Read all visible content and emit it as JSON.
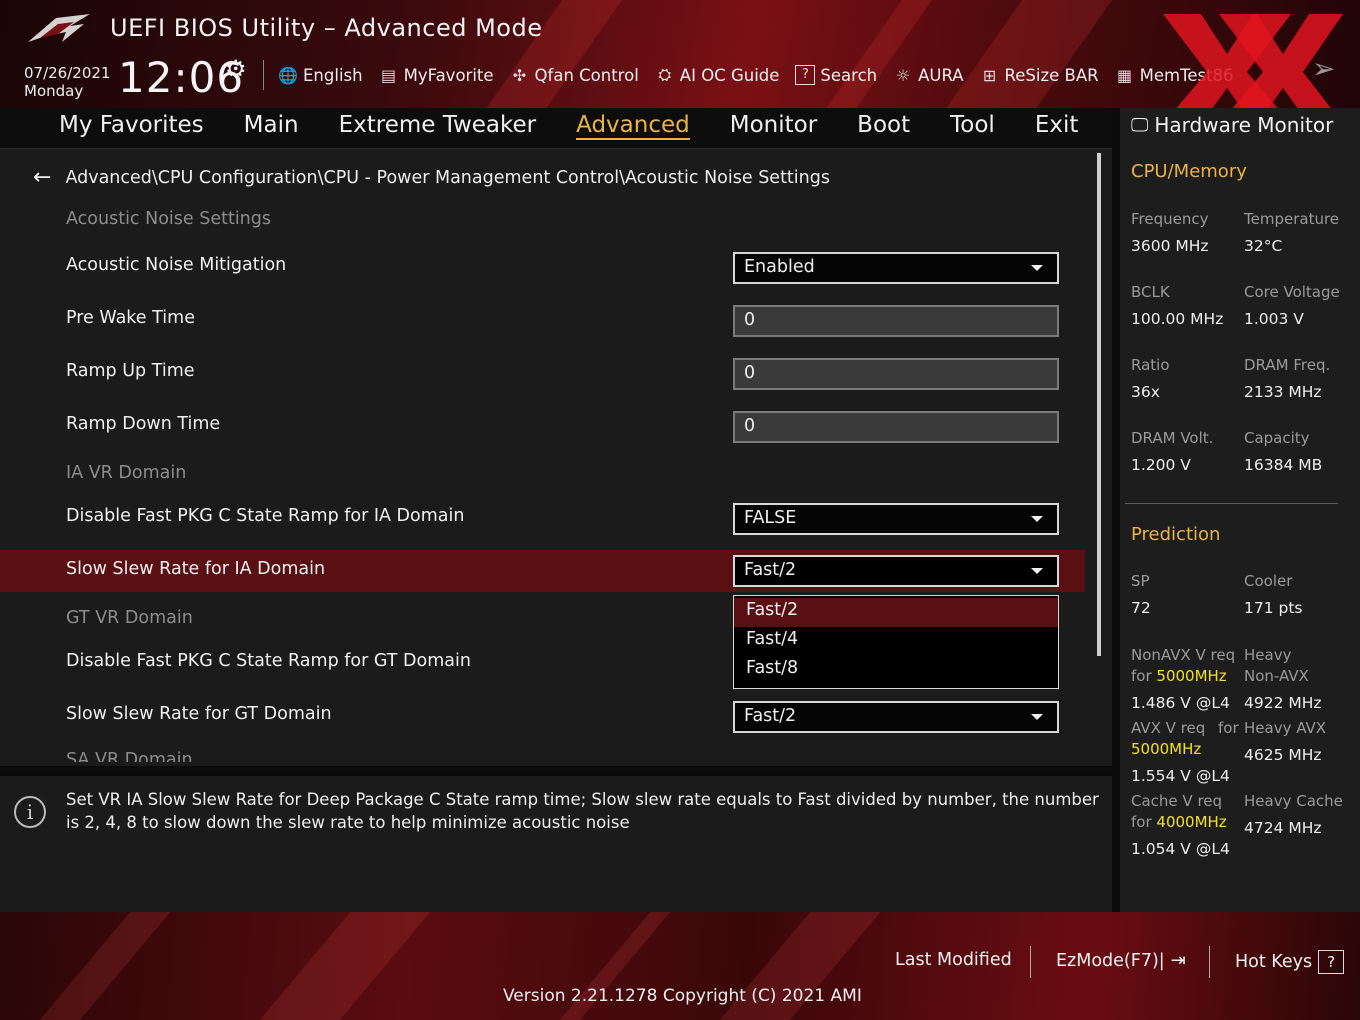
{
  "header": {
    "title": "UEFI BIOS Utility – Advanced Mode",
    "date": "07/26/2021",
    "day": "Monday",
    "time": "12:06",
    "tools": [
      {
        "label": "English",
        "icon": "globe-icon"
      },
      {
        "label": "MyFavorite",
        "icon": "favorite-icon"
      },
      {
        "label": "Qfan Control",
        "icon": "fan-icon"
      },
      {
        "label": "AI OC Guide",
        "icon": "ai-chip-icon"
      },
      {
        "label": "Search",
        "icon": "search-icon"
      },
      {
        "label": "AURA",
        "icon": "aura-light-icon"
      },
      {
        "label": "ReSize BAR",
        "icon": "resize-bar-icon"
      },
      {
        "label": "MemTest86",
        "icon": "memtest-icon"
      }
    ]
  },
  "nav": {
    "tabs": [
      "My Favorites",
      "Main",
      "Extreme Tweaker",
      "Advanced",
      "Monitor",
      "Boot",
      "Tool",
      "Exit"
    ],
    "active": "Advanced"
  },
  "main": {
    "breadcrumb": "Advanced\\CPU Configuration\\CPU - Power Management Control\\Acoustic Noise Settings",
    "rows": {
      "section1": "Acoustic Noise Settings",
      "mitigation_label": "Acoustic Noise Mitigation",
      "mitigation_value": "Enabled",
      "prewake_label": "Pre Wake Time",
      "prewake_value": "0",
      "rampup_label": "Ramp Up Time",
      "rampup_value": "0",
      "rampdown_label": "Ramp Down Time",
      "rampdown_value": "0",
      "section_ia": "IA VR Domain",
      "disable_ia_label": "Disable Fast PKG C State Ramp for IA Domain",
      "disable_ia_value": "FALSE",
      "slew_ia_label": "Slow Slew Rate for IA Domain",
      "slew_ia_value": "Fast/2",
      "section_gt": "GT VR Domain",
      "disable_gt_label": "Disable Fast PKG C State Ramp for GT Domain",
      "slew_gt_label": "Slow Slew Rate for GT Domain",
      "slew_gt_value": "Fast/2",
      "section_sa_clipped": "SA VR Domain"
    },
    "dropdown_options": [
      "Fast/2",
      "Fast/4",
      "Fast/8"
    ]
  },
  "info": {
    "text": "Set VR IA Slow Slew Rate for Deep Package C State ramp time; Slow slew rate equals to Fast divided by number, the number is 2, 4, 8 to slow down the slew rate to help minimize acoustic noise"
  },
  "hw_monitor": {
    "title": "Hardware Monitor",
    "cpu_section": "CPU/Memory",
    "cpu": [
      {
        "k": "Frequency",
        "v": "3600 MHz"
      },
      {
        "k": "Temperature",
        "v": "32°C"
      },
      {
        "k": "BCLK",
        "v": "100.00 MHz"
      },
      {
        "k": "Core Voltage",
        "v": "1.003 V"
      },
      {
        "k": "Ratio",
        "v": "36x"
      },
      {
        "k": "DRAM Freq.",
        "v": "2133 MHz"
      },
      {
        "k": "DRAM Volt.",
        "v": "1.200 V"
      },
      {
        "k": "Capacity",
        "v": "16384 MB"
      }
    ],
    "prediction_section": "Prediction",
    "sp_label": "SP",
    "sp_value": "72",
    "cooler_label": "Cooler",
    "cooler_value": "171 pts",
    "nonavx_label": "NonAVX V req",
    "nonavx_for": "for",
    "nonavx_freq": "5000MHz",
    "nonavx_value": "1.486 V @L4",
    "heavy_nonavx_label1": "Heavy",
    "heavy_nonavx_label2": "Non-AVX",
    "heavy_nonavx_value": "4922 MHz",
    "avx_label": "AVX V req",
    "avx_for": "for",
    "avx_freq": "5000MHz",
    "avx_value": "1.554 V @L4",
    "heavy_avx_label": "Heavy AVX",
    "heavy_avx_value": "4625 MHz",
    "cache_label": "Cache V req",
    "cache_for": "for",
    "cache_freq": "4000MHz",
    "cache_value": "1.054 V @L4",
    "heavy_cache_label": "Heavy Cache",
    "heavy_cache_value": "4724 MHz"
  },
  "footer": {
    "last_modified": "Last Modified",
    "ezmode": "EzMode(F7)|",
    "hotkeys": "Hot Keys",
    "hotkeys_box": "?",
    "version": "Version 2.21.1278 Copyright (C) 2021 AMI"
  },
  "colors": {
    "accent_gold": "#e9b34a",
    "selected_row": "#5a0f12",
    "highlight_yellow": "#f2e028"
  }
}
